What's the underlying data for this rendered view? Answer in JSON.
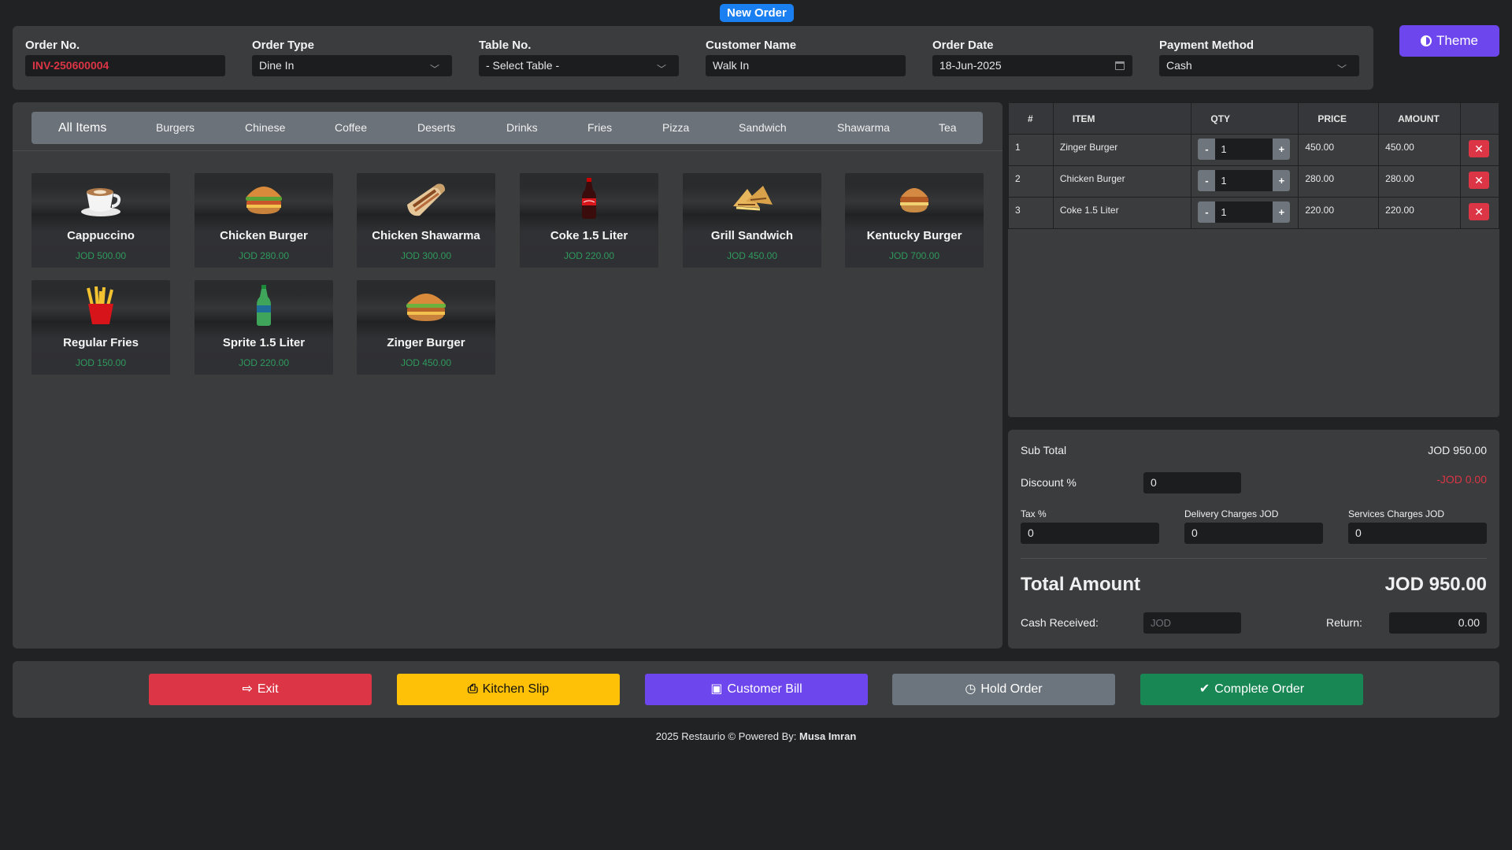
{
  "badge": "New Order",
  "header": {
    "order_no": {
      "label": "Order No.",
      "value": "INV-250600004"
    },
    "order_type": {
      "label": "Order Type",
      "value": "Dine In"
    },
    "table_no": {
      "label": "Table No.",
      "value": "- Select Table -"
    },
    "customer_name": {
      "label": "Customer Name",
      "value": "Walk In"
    },
    "order_date": {
      "label": "Order Date",
      "value": "18-Jun-2025"
    },
    "payment_method": {
      "label": "Payment Method",
      "value": "Cash"
    }
  },
  "theme_button": "Theme",
  "tabs": [
    "All Items",
    "Burgers",
    "Chinese",
    "Coffee",
    "Deserts",
    "Drinks",
    "Fries",
    "Pizza",
    "Sandwich",
    "Shawarma",
    "Tea"
  ],
  "menu_items": [
    {
      "name": "Cappuccino",
      "price": "JOD 500.00",
      "icon": "coffee-cup-icon"
    },
    {
      "name": "Chicken Burger",
      "price": "JOD 280.00",
      "icon": "burger-icon"
    },
    {
      "name": "Chicken Shawarma",
      "price": "JOD 300.00",
      "icon": "shawarma-wrap-icon"
    },
    {
      "name": "Coke 1.5 Liter",
      "price": "JOD 220.00",
      "icon": "cola-bottle-icon"
    },
    {
      "name": "Grill Sandwich",
      "price": "JOD 450.00",
      "icon": "sandwich-icon"
    },
    {
      "name": "Kentucky Burger",
      "price": "JOD 700.00",
      "icon": "burger-icon"
    },
    {
      "name": "Regular Fries",
      "price": "JOD 150.00",
      "icon": "fries-icon"
    },
    {
      "name": "Sprite 1.5 Liter",
      "price": "JOD 220.00",
      "icon": "soda-bottle-icon"
    },
    {
      "name": "Zinger Burger",
      "price": "JOD 450.00",
      "icon": "burger-icon"
    }
  ],
  "cart": {
    "columns": [
      "#",
      "ITEM",
      "QTY",
      "PRICE",
      "AMOUNT",
      ""
    ],
    "rows": [
      {
        "no": "1",
        "item": "Zinger Burger",
        "qty": "1",
        "price": "450.00",
        "amount": "450.00"
      },
      {
        "no": "2",
        "item": "Chicken Burger",
        "qty": "1",
        "price": "280.00",
        "amount": "280.00"
      },
      {
        "no": "3",
        "item": "Coke 1.5 Liter",
        "qty": "1",
        "price": "220.00",
        "amount": "220.00"
      }
    ],
    "minus": "-",
    "plus": "+",
    "remove": "✕"
  },
  "totals": {
    "subtotal_label": "Sub Total",
    "subtotal_value": "JOD 950.00",
    "discount_label": "Discount %",
    "discount_value": "0",
    "discount_amount": "-JOD 0.00",
    "tax_label": "Tax %",
    "tax_value": "0",
    "delivery_label": "Delivery Charges JOD",
    "delivery_value": "0",
    "services_label": "Services Charges JOD",
    "services_value": "0",
    "total_label": "Total Amount",
    "total_value": "JOD 950.00",
    "cash_label": "Cash Received:",
    "cash_placeholder": "JOD",
    "return_label": "Return:",
    "return_value": "0.00"
  },
  "actions": {
    "exit": "Exit",
    "kitchen_slip": "Kitchen Slip",
    "customer_bill": "Customer Bill",
    "hold_order": "Hold Order",
    "complete_order": "Complete Order"
  },
  "footer": {
    "text": "2025 Restaurio © Powered By:",
    "author": "Musa Imran"
  },
  "colors": {
    "accent": "#6d46ee",
    "danger": "#dc3545",
    "warning": "#ffc107",
    "success": "#198754",
    "primary": "#1a7ff0",
    "secondary": "#6c757d",
    "price_green": "#2e9a5e"
  }
}
